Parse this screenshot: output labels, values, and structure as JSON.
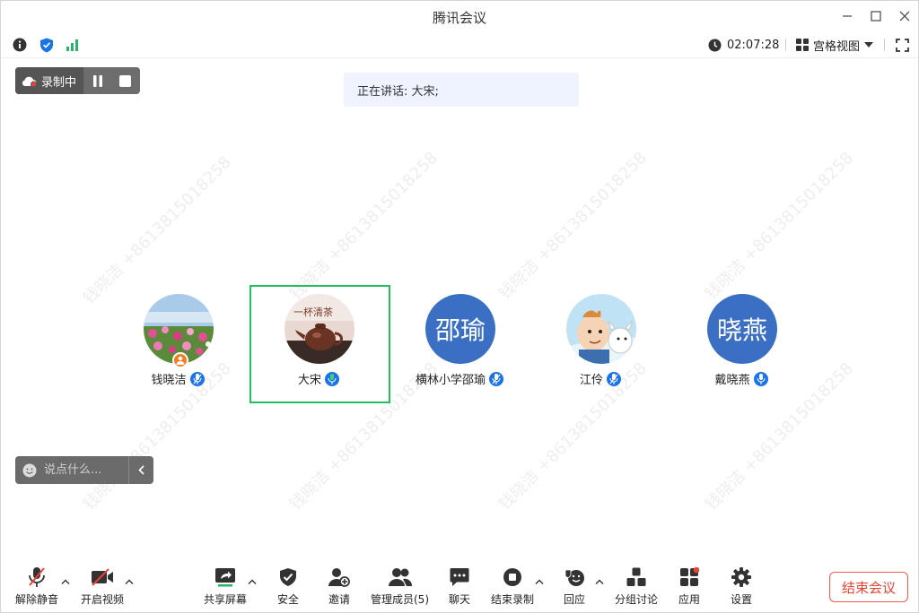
{
  "window": {
    "title": "腾讯会议"
  },
  "infobar": {
    "timer": "02:07:28",
    "view_mode": "宫格视图"
  },
  "recording": {
    "label": "录制中"
  },
  "speaking": {
    "text": "正在讲话: 大宋;"
  },
  "watermark": "钱晓洁 +8613815018258",
  "participants": [
    {
      "name": "钱晓洁",
      "avatar_type": "photo-flowers",
      "host": true
    },
    {
      "name": "大宋",
      "avatar_type": "photo-teapot",
      "active_speaker": true
    },
    {
      "name": "横林小学邵瑜",
      "avatar_text": "邵瑜"
    },
    {
      "name": "江伶",
      "avatar_type": "photo-cartoon"
    },
    {
      "name": "戴晓燕",
      "avatar_text": "晓燕"
    }
  ],
  "chat": {
    "placeholder": "说点什么..."
  },
  "toolbar": {
    "unmute": "解除静音",
    "start_video": "开启视频",
    "share_screen": "共享屏幕",
    "security": "安全",
    "invite": "邀请",
    "manage_members": "管理成员(5)",
    "chat": "聊天",
    "end_recording": "结束录制",
    "reactions": "回应",
    "breakout": "分组讨论",
    "apps": "应用",
    "settings": "设置",
    "end_meeting": "结束会议"
  },
  "colors": {
    "accent": "#1a73e8",
    "active_frame": "#25c05e",
    "end": "#ea4335",
    "avatar_blue": "#3b6fc4"
  }
}
